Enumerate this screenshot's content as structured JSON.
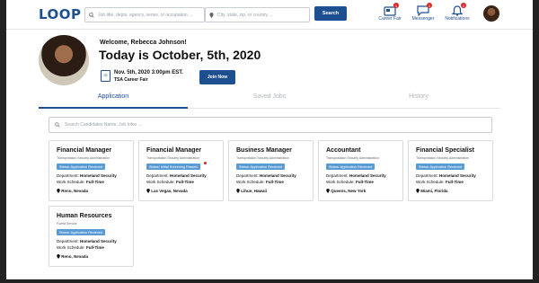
{
  "header": {
    "logo": "LOOP",
    "search_placeholder": "Job title, depts, agency, series, or occupation ...",
    "location_placeholder": "City, state, zip, or country ...",
    "search_button": "Search",
    "nav": [
      {
        "label": "Career Fair",
        "badge": "1",
        "icon": "career-fair-icon"
      },
      {
        "label": "Messenger",
        "badge": "1",
        "icon": "messenger-icon"
      },
      {
        "label": "Notifications",
        "badge": "2",
        "icon": "bell-icon"
      }
    ]
  },
  "profile": {
    "welcome": "Welcome, Rebecca Johnson!",
    "today": "Today is October, 5th, 2020",
    "calendar_day": "05",
    "event_time": "Nov. 5th, 2020 3:00pm EST.",
    "event_name": "TSA Career Fair",
    "join_button": "Join Now"
  },
  "tabs": [
    "Application",
    "Saved Jobs",
    "History"
  ],
  "active_tab": "Application",
  "candidate_search_placeholder": "Search Candidates Name, Job Infos ...",
  "dept_label": "Department:",
  "schedule_label": "Work Schedule:",
  "cards": [
    {
      "title": "Financial Manager",
      "org": "Transportation Security Administration",
      "status": "Status: Application Recieved",
      "department": "Homeland Security",
      "schedule": "Full-Time",
      "location": "Reno, Nevada",
      "new": false
    },
    {
      "title": "Financial Manager",
      "org": "Transportation Security Administration",
      "status": "Status: Initial Screening Passed",
      "department": "Homeland Security",
      "schedule": "Full-Time",
      "location": "Las Vegas, Nevada",
      "new": true
    },
    {
      "title": "Business Manager",
      "org": "Transportation Security Administration",
      "status": "Status: Application Recieved",
      "department": "Homeland Security",
      "schedule": "Full-Time",
      "location": "Lihue, Hawaii",
      "new": false
    },
    {
      "title": "Accountant",
      "org": "Transportation Security Administration",
      "status": "Status: Application Recieved",
      "department": "Homeland Security",
      "schedule": "Full-Time",
      "location": "Queens, New York",
      "new": false
    },
    {
      "title": "Financial Specialist",
      "org": "Transportation Security Administration",
      "status": "Status: Application Recieved",
      "department": "Homeland Security",
      "schedule": "Full-Time",
      "location": "Miami, Florida",
      "new": false
    },
    {
      "title": "Human Resources",
      "org": "Forest Service",
      "status": "Status: Application Recieved",
      "department": "Homeland Security",
      "schedule": "Full-Time",
      "location": "Reno, Nevada",
      "new": false
    }
  ],
  "colors": {
    "brand": "#1d4f91",
    "status": "#5b9bd5",
    "badge": "#e02424"
  }
}
